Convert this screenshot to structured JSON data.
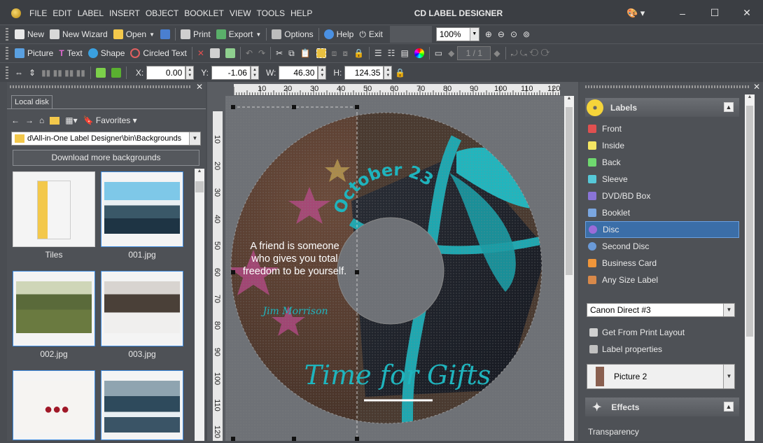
{
  "app": {
    "title": "CD LABEL DESIGNER"
  },
  "menu": [
    "FILE",
    "EDIT",
    "LABEL",
    "INSERT",
    "OBJECT",
    "BOOKLET",
    "VIEW",
    "TOOLS",
    "HELP"
  ],
  "toolbar1": {
    "new": "New",
    "wizard": "New Wizard",
    "open": "Open",
    "print": "Print",
    "export": "Export",
    "options": "Options",
    "help": "Help",
    "exit": "Exit",
    "zoom": "100%"
  },
  "toolbar2": {
    "picture": "Picture",
    "text": "Text",
    "shape": "Shape",
    "circled_text": "Circled Text",
    "page": "1 / 1"
  },
  "toolbar3": {
    "x_label": "X:",
    "x": "0.00",
    "y_label": "Y:",
    "y": "-1.06",
    "w_label": "W:",
    "w": "46.30",
    "h_label": "H:",
    "h": "124.35"
  },
  "left_panel": {
    "tab": "Local disk",
    "favorites": "Favorites",
    "path": "d\\All-in-One Label Designer\\bin\\Backgrounds",
    "download": "Download more backgrounds",
    "thumbs": [
      "Tiles",
      "001.jpg",
      "002.jpg",
      "003.jpg"
    ]
  },
  "ruler": {
    "h": [
      "10",
      "20",
      "30",
      "40",
      "50",
      "60",
      "70",
      "80",
      "90",
      "100",
      "110",
      "120"
    ],
    "v": [
      "10",
      "20",
      "30",
      "40",
      "50",
      "60",
      "70",
      "80",
      "90",
      "100",
      "110",
      "120"
    ]
  },
  "disc": {
    "date": "October 23",
    "quote": "A friend is someone who gives you total freedom to be yourself.",
    "author": "Jim Morrison",
    "headline": "Time for Gifts"
  },
  "right_panel": {
    "labels_title": "Labels",
    "items": [
      {
        "label": "Front",
        "color": "#e05050"
      },
      {
        "label": "Inside",
        "color": "#f5e663"
      },
      {
        "label": "Back",
        "color": "#6fd86f"
      },
      {
        "label": "Sleeve",
        "color": "#56c8d8"
      },
      {
        "label": "DVD/BD Box",
        "color": "#8a74d8"
      },
      {
        "label": "Booklet",
        "color": "#7aa6e0"
      },
      {
        "label": "Disc",
        "color": "#9b6bd8"
      },
      {
        "label": "Second Disc",
        "color": "#6a9ad8"
      },
      {
        "label": "Business Card",
        "color": "#f0963a"
      },
      {
        "label": "Any Size Label",
        "color": "#d8894a"
      }
    ],
    "printer": "Canon Direct #3",
    "get_layout": "Get From Print Layout",
    "label_props": "Label properties",
    "object": "Picture 2",
    "effects_title": "Effects",
    "transparency": "Transparency"
  }
}
